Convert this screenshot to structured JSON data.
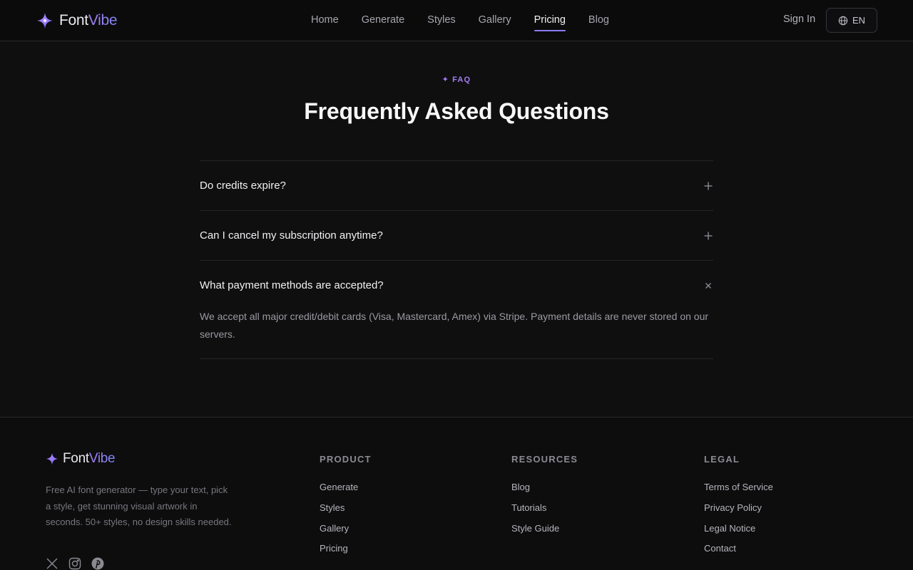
{
  "brand": {
    "name_part1": "Font",
    "name_part2": "Vibe"
  },
  "header": {
    "nav": [
      {
        "label": "Home"
      },
      {
        "label": "Generate"
      },
      {
        "label": "Styles"
      },
      {
        "label": "Gallery"
      },
      {
        "label": "Pricing",
        "active": true
      },
      {
        "label": "Blog"
      }
    ],
    "signin_label": "Sign In",
    "lang_label": "EN"
  },
  "faq": {
    "tag": "FAQ",
    "title": "Frequently Asked Questions",
    "items": [
      {
        "question": "Do credits expire?",
        "expanded": false
      },
      {
        "question": "Can I cancel my subscription anytime?",
        "expanded": false
      },
      {
        "question": "What payment methods are accepted?",
        "expanded": true,
        "answer": "We accept all major credit/debit cards (Visa, Mastercard, Amex) via Stripe. Payment details are never stored on our servers."
      }
    ]
  },
  "footer": {
    "description": "Free AI font generator — type your text, pick a style, get stunning visual artwork in seconds. 50+ styles, no design skills needed.",
    "socials": [
      "x-icon",
      "instagram-icon",
      "pinterest-icon"
    ],
    "columns": [
      {
        "title": "PRODUCT",
        "links": [
          "Generate",
          "Styles",
          "Gallery",
          "Pricing"
        ]
      },
      {
        "title": "RESOURCES",
        "links": [
          "Blog",
          "Tutorials",
          "Style Guide"
        ]
      },
      {
        "title": "LEGAL",
        "links": [
          "Terms of Service",
          "Privacy Policy",
          "Legal Notice",
          "Contact"
        ]
      }
    ]
  },
  "colors": {
    "accent": "#9d7cf3",
    "background": "#0f0f10"
  }
}
